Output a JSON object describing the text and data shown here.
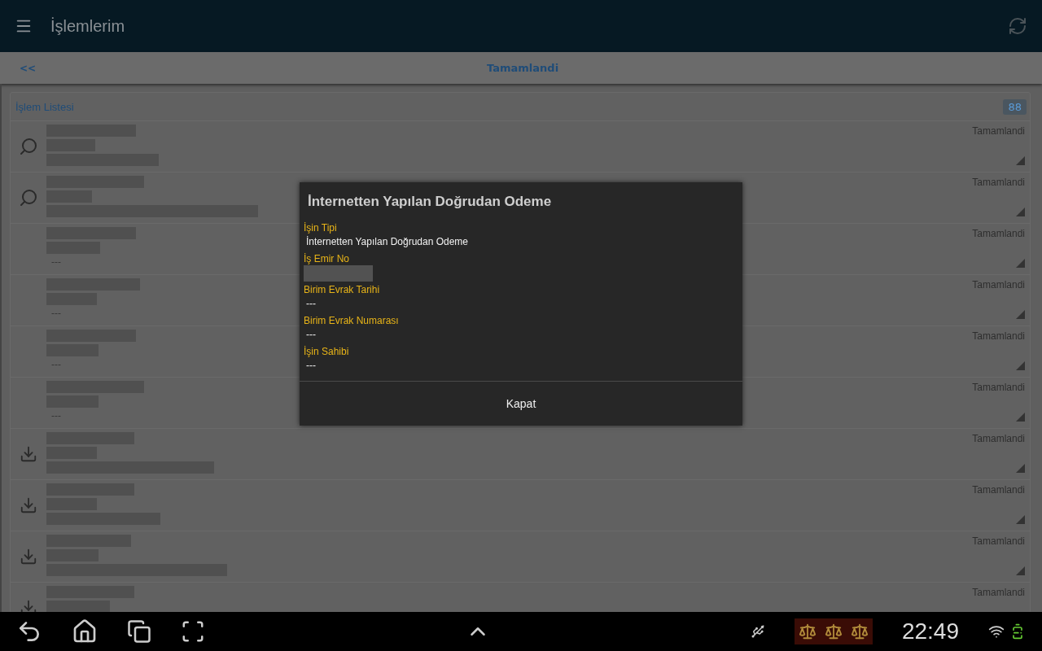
{
  "app_bar": {
    "title": "İşlemlerim"
  },
  "sub_bar": {
    "back": "<<",
    "title": "Tamamlandi"
  },
  "list": {
    "title": "İşlem Listesi",
    "count": "88",
    "rows": [
      {
        "kind": "search",
        "status": "Tamamlandi",
        "corner_mark": true
      },
      {
        "kind": "search",
        "status": "Tamamlandi",
        "corner_mark": true
      },
      {
        "kind": "plain",
        "status": "Tamamlandi",
        "note": "---",
        "corner_mark": true
      },
      {
        "kind": "plain",
        "status": "Tamamlandi",
        "note": "---",
        "corner_mark": true
      },
      {
        "kind": "plain",
        "status": "Tamamlandi",
        "note": "---",
        "corner_mark": true
      },
      {
        "kind": "plain",
        "status": "Tamamlandi",
        "note": "---",
        "corner_mark": true
      },
      {
        "kind": "download",
        "status": "Tamamlandi",
        "corner_mark": true
      },
      {
        "kind": "download",
        "status": "Tamamlandi",
        "corner_mark": true
      },
      {
        "kind": "download",
        "status": "Tamamlandi",
        "corner_mark": true
      },
      {
        "kind": "download",
        "status": "Tamamlandi"
      }
    ]
  },
  "dialog": {
    "title": "İnternetten Yapılan Doğrudan Odeme",
    "fields": [
      {
        "label": "İşin Tipi",
        "value": "İnternetten Yapılan Doğrudan Odeme"
      },
      {
        "label": "İş Emir No",
        "redacted": true
      },
      {
        "label": "Birim Evrak Tarihi",
        "value": "---"
      },
      {
        "label": "Birim Evrak Numarası",
        "value": "---"
      },
      {
        "label": "İşin Sahibi",
        "value": "---"
      }
    ],
    "button": "Kapat"
  },
  "system_bar": {
    "time": "22:49"
  }
}
